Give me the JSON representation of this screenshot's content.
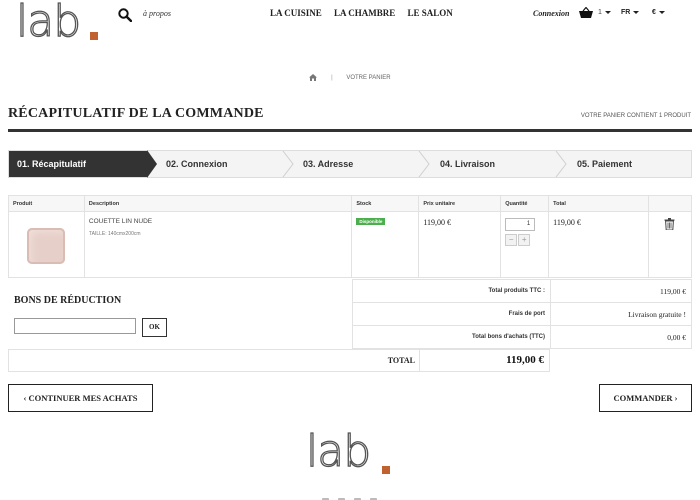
{
  "header": {
    "logo": "lab",
    "about": "à propos",
    "nav": [
      "LA CUISINE",
      "LA CHAMBRE",
      "LE SALON"
    ],
    "login": "Connexion",
    "cart_count": "1",
    "language": "FR",
    "currency": "€"
  },
  "breadcrumb": {
    "current": "VOTRE PANIER"
  },
  "page": {
    "title": "RÉCAPITULATIF DE LA COMMANDE",
    "cart_summary": "VOTRE PANIER CONTIENT 1 PRODUIT"
  },
  "steps": [
    "01. Récapitulatif",
    "02. Connexion",
    "03. Adresse",
    "04. Livraison",
    "05. Paiement"
  ],
  "table": {
    "headers": [
      "Produit",
      "Description",
      "Stock",
      "Prix unitaire",
      "Quantité",
      "Total"
    ],
    "rows": [
      {
        "name": "COUETTE LIN NUDE",
        "attributes": "TAILLE: 140cmx200cm",
        "stock": "Disponible",
        "unit_price": "119,00 €",
        "quantity": "1",
        "total": "119,00 €"
      }
    ]
  },
  "voucher": {
    "title": "BONS DE RÉDUCTION",
    "ok": "OK"
  },
  "totals": [
    {
      "label": "Total produits TTC :",
      "value": "119,00 €"
    },
    {
      "label": "Frais de port",
      "value": "Livraison gratuite !"
    },
    {
      "label": "Total bons d'achats (TTC)",
      "value": "0,00 €"
    }
  ],
  "grand_total": {
    "label": "TOTAL",
    "value": "119,00 €"
  },
  "actions": {
    "continue": "CONTINUER MES ACHATS",
    "order": "COMMANDER"
  },
  "colors": {
    "accent": "#c0622f",
    "dark": "#333333",
    "stock": "#4cae4c"
  }
}
